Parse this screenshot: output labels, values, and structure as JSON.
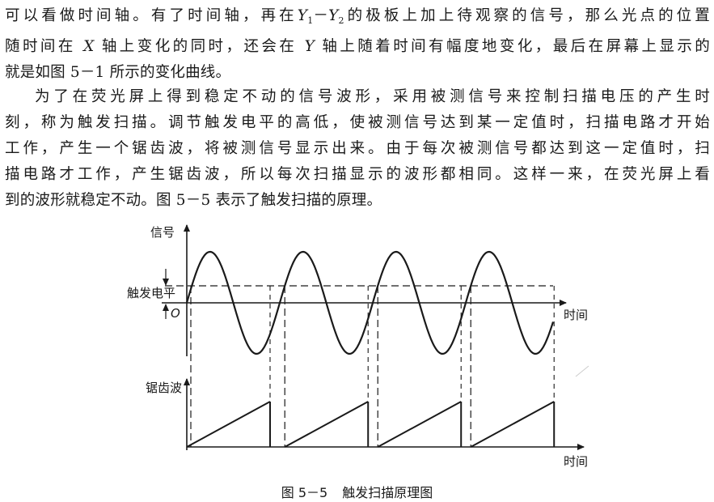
{
  "paragraph1": {
    "line1_a": "可以看做时间轴。有了时间轴，再在",
    "y1": "Y",
    "y1_sub": "1",
    "dash": "－",
    "y2": "Y",
    "y2_sub": "2",
    "line1_b": "的极板上加上待观察的信号，那么光点的位置",
    "line2_a": "随时间在",
    "x_axis": "X",
    "line2_b": "轴上变化的同时，还会在",
    "y_axis": "Y",
    "line2_c": "轴上随着时间有幅度地变化，最后在屏幕上显示的",
    "line3": "就是如图 5－1 所示的变化曲线。"
  },
  "paragraph2": {
    "lines": [
      "为了在荧光屏上得到稳定不动的信号波形，采用被测信号来控制扫描电压的产生时",
      "刻，称为触发扫描。调节触发电平的高低，使被测信号达到某一定值时，扫描电路才开始",
      "工作，产生一个锯齿波，将被测信号显示出来。由于每次被测信号都达到这一定值时，扫",
      "描电路才工作，产生锯齿波，所以每次扫描显示的波形都相同。这样一来，在荧光屏上看",
      "到的波形就稳定不动。图 5－5 表示了触发扫描的原理。"
    ]
  },
  "figure": {
    "label_signal": "信号",
    "label_trigger_level": "触发电平",
    "label_origin": "O",
    "label_time_top": "时间",
    "label_sawtooth": "锯齿波",
    "label_time_bottom": "时间",
    "caption_number": "图 5－5",
    "caption_title": "触发扫描原理图"
  },
  "chart_data": {
    "type": "line",
    "title": "触发扫描原理图",
    "series": [
      {
        "name": "信号",
        "kind": "sine",
        "periods": 4
      },
      {
        "name": "锯齿波",
        "kind": "sawtooth",
        "ramps": 4
      }
    ],
    "annotations": [
      "触发电平",
      "O"
    ],
    "xlabel": "时间",
    "ylabel": "信号"
  }
}
